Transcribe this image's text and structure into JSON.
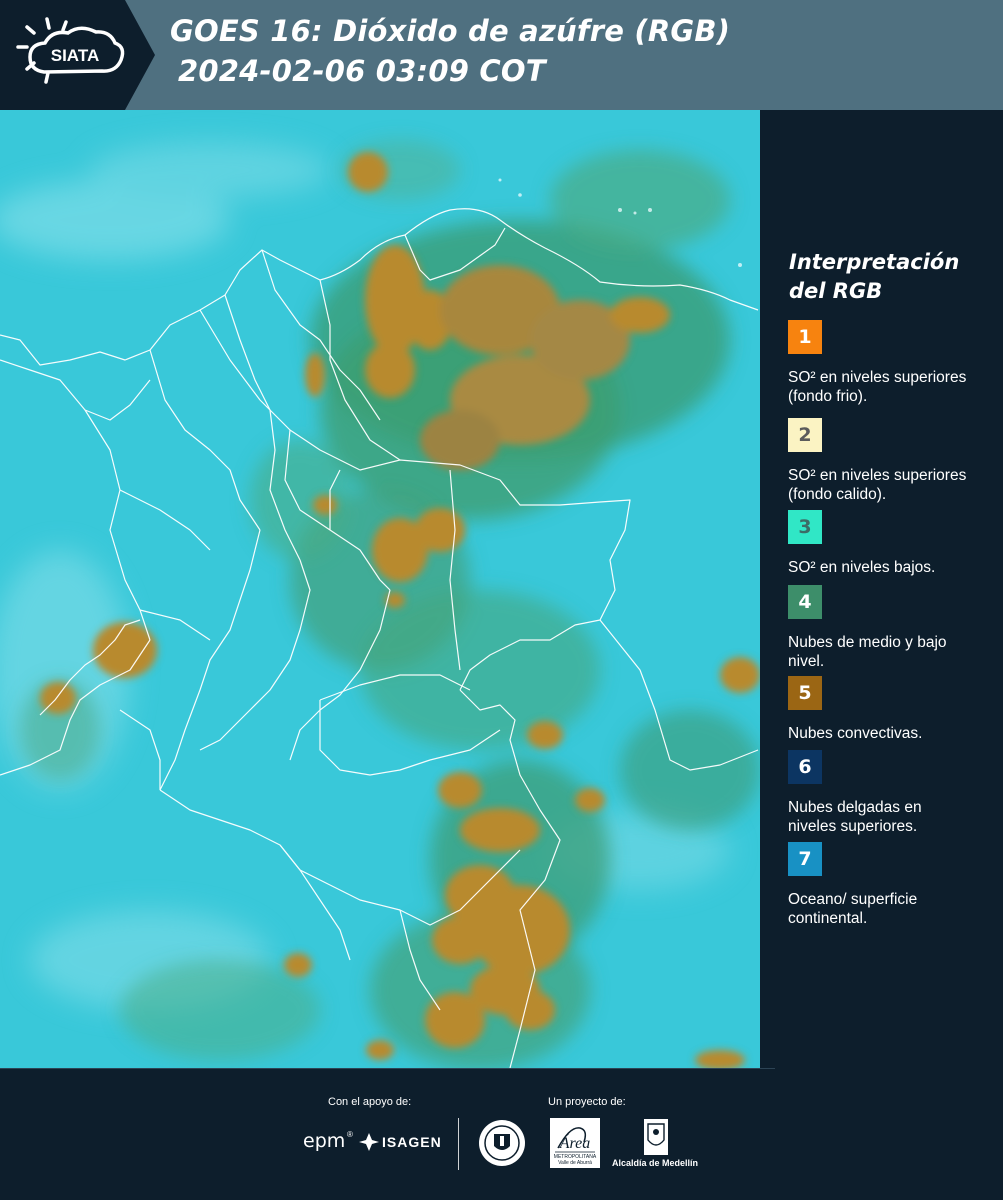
{
  "header": {
    "logo_text": "SIATA",
    "title_line1": "GOES 16: Dióxido de azúfre (RGB)",
    "title_line2": "2024-02-06 03:09 COT"
  },
  "map": {
    "icon": "satellite-map",
    "colors": {
      "ocean": "#36c7d8",
      "land": "#2f9e7c",
      "convective": "#b5892d",
      "border": "#ffffff"
    }
  },
  "legend": {
    "title": "Interpretación del RGB",
    "items": [
      {
        "number": "1",
        "description": "SO² en niveles superiores (fondo frio).",
        "color": "#f7830f",
        "text_color": "#ffffff"
      },
      {
        "number": "2",
        "description": "SO² en niveles superiores (fondo calido).",
        "color": "#fbf3c3",
        "text_color": "#5b5b5b"
      },
      {
        "number": "3",
        "description": "SO² en niveles bajos.",
        "color": "#30e7c6",
        "text_color": "#3c6c66"
      },
      {
        "number": "4",
        "description": "Nubes de medio y bajo nivel.",
        "color": "#3d8e6a",
        "text_color": "#ffffff"
      },
      {
        "number": "5",
        "description": "Nubes convectivas.",
        "color": "#9b6614",
        "text_color": "#ffffff"
      },
      {
        "number": "6",
        "description": "Nubes delgadas en niveles superiores.",
        "color": "#0c3562",
        "text_color": "#ffffff"
      },
      {
        "number": "7",
        "description": "Oceano/ superficie continental.",
        "color": "#1891c4",
        "text_color": "#ffffff"
      }
    ]
  },
  "footer": {
    "support_caption": "Con el apoyo de:",
    "project_caption": "Un proyecto de:",
    "sponsor_epm": "epm",
    "sponsor_isagen": "ISAGEN",
    "area_logo_main": "Área",
    "area_logo_line1": "METROPOLITANA",
    "area_logo_line2": "Valle de Aburrá",
    "alcaldia_label": "Alcaldía de Medellín"
  }
}
